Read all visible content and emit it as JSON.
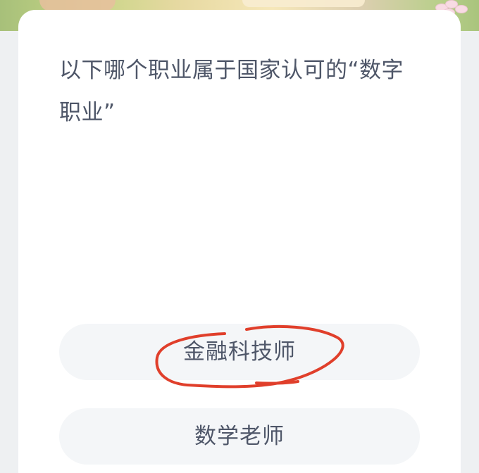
{
  "question": {
    "text": "以下哪个职业属于国家认可的“数字职业”"
  },
  "options": [
    {
      "label": "金融科技师"
    },
    {
      "label": "数学老师"
    }
  ],
  "annotation": {
    "color": "#e03f2b"
  }
}
